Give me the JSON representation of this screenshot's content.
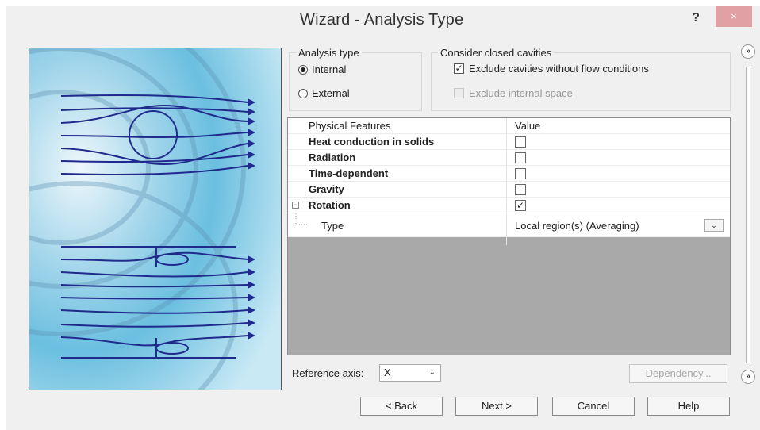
{
  "window": {
    "title": "Wizard - Analysis Type",
    "help_glyph": "?",
    "close_glyph": "×"
  },
  "analysis_type": {
    "label": "Analysis type",
    "options": [
      {
        "label": "Internal",
        "selected": true
      },
      {
        "label": "External",
        "selected": false
      }
    ]
  },
  "cavities": {
    "label": "Consider closed cavities",
    "options": [
      {
        "label": "Exclude cavities without flow conditions",
        "checked": true,
        "enabled": true
      },
      {
        "label": "Exclude internal space",
        "checked": false,
        "enabled": false
      }
    ]
  },
  "features_table": {
    "headers": [
      "Physical Features",
      "Value"
    ],
    "rows": [
      {
        "name": "Heat conduction in solids",
        "checked": false
      },
      {
        "name": "Radiation",
        "checked": false
      },
      {
        "name": "Time-dependent",
        "checked": false
      },
      {
        "name": "Gravity",
        "checked": false
      },
      {
        "name": "Rotation",
        "checked": true,
        "expander": "−"
      }
    ],
    "child": {
      "name": "Type",
      "value": "Local region(s) (Averaging)"
    }
  },
  "reference_axis": {
    "label": "Reference axis:",
    "value": "X"
  },
  "buttons": {
    "dependency": "Dependency...",
    "back": "< Back",
    "next": "Next >",
    "cancel": "Cancel",
    "help": "Help"
  },
  "side_glyph": "»",
  "colors": {
    "close": "#e0a0a4",
    "window_bg": "#f0f0f0",
    "diagram_ink": "#1f2a8c"
  }
}
